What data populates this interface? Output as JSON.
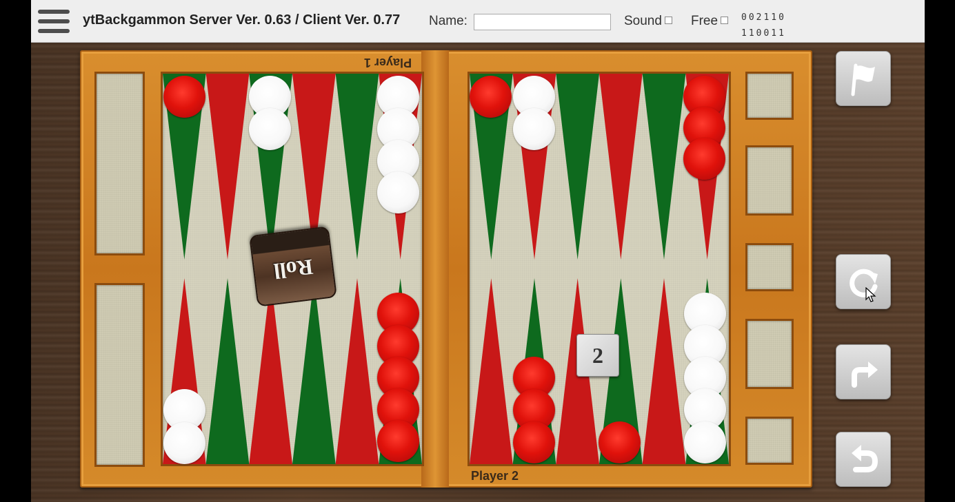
{
  "header": {
    "title": "ytBackgammon Server Ver. 0.63 / Client Ver. 0.77",
    "name_label": "Name:",
    "name_value": "",
    "sound_label": "Sound",
    "free_label": "Free",
    "code_line1": "002110",
    "code_line2": "110011"
  },
  "board": {
    "player_top": "Player 1",
    "player_bottom": "Player 2",
    "roll_label": "Roll",
    "die_value": "2",
    "colors": {
      "red_checker": "#e0120b",
      "white_checker": "#f8f8f8",
      "red_point": "#c81818",
      "green_point": "#0e6a1e",
      "felt": "#d5d2bd",
      "frame": "#c9771d"
    }
  },
  "side_buttons": [
    {
      "name": "resign-flag-button",
      "icon": "flag-icon"
    },
    {
      "name": "reload-button",
      "icon": "refresh-icon"
    },
    {
      "name": "forward-button",
      "icon": "redo-arrow-icon"
    },
    {
      "name": "undo-button",
      "icon": "undo-arrow-icon"
    }
  ]
}
